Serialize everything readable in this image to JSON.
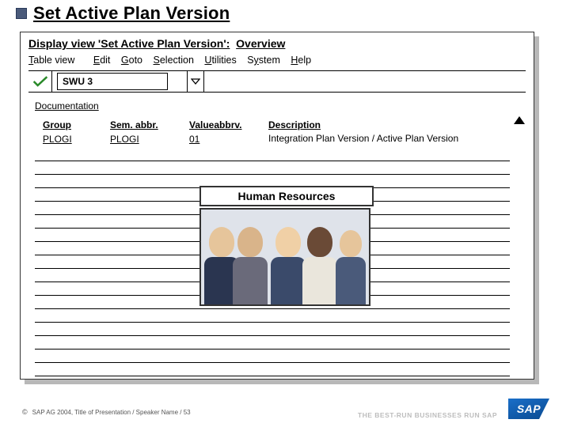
{
  "title": "Set Active Plan Version",
  "window": {
    "title_left": "Display view 'Set Active Plan Version':",
    "title_right": "Overview"
  },
  "menu": {
    "tableview": "Table view",
    "edit": "Edit",
    "goto": "Goto",
    "selection": "Selection",
    "utilities": "Utilities",
    "system": "System",
    "help": "Help"
  },
  "tcode": "SWU 3",
  "doc_link": "Documentation",
  "grid": {
    "headers": {
      "group": "Group",
      "sem": "Sem. abbr.",
      "val": "Valueabbrv.",
      "desc": "Description"
    },
    "row": {
      "group": "PLOGI",
      "sem": "PLOGI",
      "val": "01",
      "desc": "Integration Plan Version / Active Plan Version"
    }
  },
  "hr_title": "Human Resources",
  "footer": {
    "copy": "©",
    "text": "SAP AG 2004,  Title of Presentation / Speaker Name / 53",
    "tagline": "THE BEST-RUN BUSINESSES RUN SAP",
    "logo": "SAP"
  }
}
